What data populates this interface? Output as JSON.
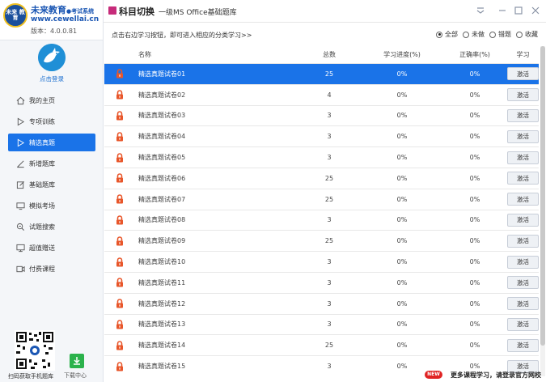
{
  "brand": {
    "logo_text": "未来\n教育",
    "name": "未来教育",
    "name_sub": "●考试系统",
    "url": "www.cewellai.cn",
    "version": "版本：4.0.0.81"
  },
  "user": {
    "login_label": "点击登录"
  },
  "nav": [
    {
      "label": "我的主页",
      "icon": "home-icon",
      "active": false
    },
    {
      "label": "专项训练",
      "icon": "play-icon",
      "active": false
    },
    {
      "label": "精选真题",
      "icon": "play-icon",
      "active": true
    },
    {
      "label": "新增题库",
      "icon": "pen-icon",
      "active": false
    },
    {
      "label": "基础题库",
      "icon": "edit-icon",
      "active": false
    },
    {
      "label": "模拟考场",
      "icon": "monitor-icon",
      "active": false
    },
    {
      "label": "试题搜索",
      "icon": "search-icon",
      "active": false
    },
    {
      "label": "超值赠送",
      "icon": "screen-icon",
      "active": false
    },
    {
      "label": "付费课程",
      "icon": "video-icon",
      "active": false
    }
  ],
  "qr_label": "扫码获取手机题库",
  "download_label": "下载中心",
  "header": {
    "switch_label": "科目切换",
    "subject": "一级MS Office基础题库"
  },
  "filter": {
    "hint": "点击右边学习按钮，即可进入相应的分类学习>>",
    "options": [
      "全部",
      "未做",
      "错题",
      "收藏"
    ],
    "selected": "全部"
  },
  "table": {
    "headers": [
      "名称",
      "总数",
      "学习进度(%)",
      "正确率(%)",
      "学习"
    ],
    "action_label": "激活",
    "rows": [
      {
        "name": "精选真题试卷01",
        "total": "25",
        "progress": "0%",
        "accuracy": "0%"
      },
      {
        "name": "精选真题试卷02",
        "total": "4",
        "progress": "0%",
        "accuracy": "0%"
      },
      {
        "name": "精选真题试卷03",
        "total": "3",
        "progress": "0%",
        "accuracy": "0%"
      },
      {
        "name": "精选真题试卷04",
        "total": "3",
        "progress": "0%",
        "accuracy": "0%"
      },
      {
        "name": "精选真题试卷05",
        "total": "3",
        "progress": "0%",
        "accuracy": "0%"
      },
      {
        "name": "精选真题试卷06",
        "total": "25",
        "progress": "0%",
        "accuracy": "0%"
      },
      {
        "name": "精选真题试卷07",
        "total": "25",
        "progress": "0%",
        "accuracy": "0%"
      },
      {
        "name": "精选真题试卷08",
        "total": "3",
        "progress": "0%",
        "accuracy": "0%"
      },
      {
        "name": "精选真题试卷09",
        "total": "25",
        "progress": "0%",
        "accuracy": "0%"
      },
      {
        "name": "精选真题试卷10",
        "total": "3",
        "progress": "0%",
        "accuracy": "0%"
      },
      {
        "name": "精选真题试卷11",
        "total": "3",
        "progress": "0%",
        "accuracy": "0%"
      },
      {
        "name": "精选真题试卷12",
        "total": "3",
        "progress": "0%",
        "accuracy": "0%"
      },
      {
        "name": "精选真题试卷13",
        "total": "3",
        "progress": "0%",
        "accuracy": "0%"
      },
      {
        "name": "精选真题试卷14",
        "total": "25",
        "progress": "0%",
        "accuracy": "0%"
      },
      {
        "name": "精选真题试卷15",
        "total": "3",
        "progress": "0%",
        "accuracy": "0%"
      }
    ]
  },
  "footer": {
    "badge": "NEW",
    "text": "更多课程学习，请登录官方网校"
  },
  "colors": {
    "accent": "#1a73e8",
    "lock": "#e8562a",
    "brand": "#1a56b3"
  }
}
